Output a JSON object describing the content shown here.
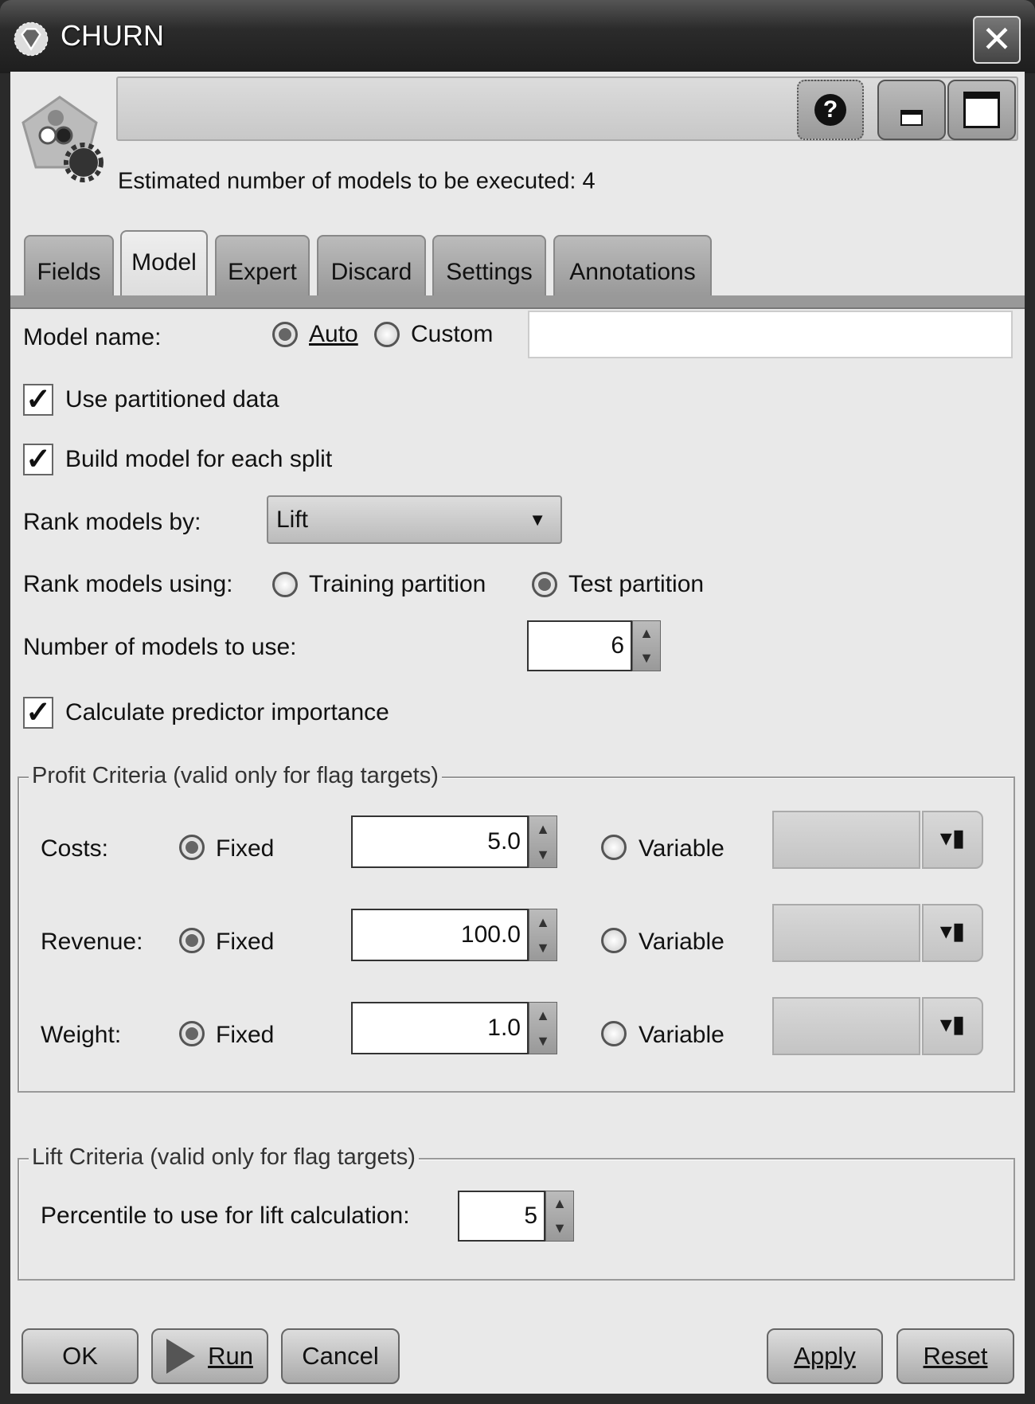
{
  "window": {
    "title": "CHURN",
    "close_icon": "close-icon",
    "app_icon": "diamond-icon"
  },
  "header": {
    "node_icon": "auto-classifier-node-icon",
    "estimate_text": "Estimated number of models to be executed: 4",
    "help_icon": "help-icon"
  },
  "tabs": [
    {
      "label": "Fields"
    },
    {
      "label": "Model",
      "active": true
    },
    {
      "label": "Expert"
    },
    {
      "label": "Discard"
    },
    {
      "label": "Settings"
    },
    {
      "label": "Annotations"
    }
  ],
  "model": {
    "model_name_label": "Model name:",
    "auto_label": "Auto",
    "custom_label": "Custom",
    "model_name_mode": "Auto",
    "custom_value": "",
    "use_partitioned_label": "Use partitioned data",
    "use_partitioned": true,
    "build_each_split_label": "Build model for each split",
    "build_each_split": true,
    "rank_by_label": "Rank models by:",
    "rank_by_value": "Lift",
    "rank_using_label": "Rank models using:",
    "training_label": "Training partition",
    "test_label": "Test partition",
    "rank_using": "Test partition",
    "num_models_label": "Number of models to use:",
    "num_models": "6",
    "predictor_importance_label": "Calculate predictor importance",
    "predictor_importance": true
  },
  "profit": {
    "title": "Profit Criteria (valid only for flag targets)",
    "fixed_label": "Fixed",
    "variable_label": "Variable",
    "rows": [
      {
        "label": "Costs:",
        "value": "5.0"
      },
      {
        "label": "Revenue:",
        "value": "100.0"
      },
      {
        "label": "Weight:",
        "value": "1.0"
      }
    ]
  },
  "lift": {
    "title": "Lift Criteria (valid only for flag targets)",
    "percentile_label": "Percentile to use for lift calculation:",
    "percentile": "5"
  },
  "buttons": {
    "ok": "OK",
    "run": "Run",
    "cancel": "Cancel",
    "apply": "Apply",
    "reset": "Reset"
  }
}
